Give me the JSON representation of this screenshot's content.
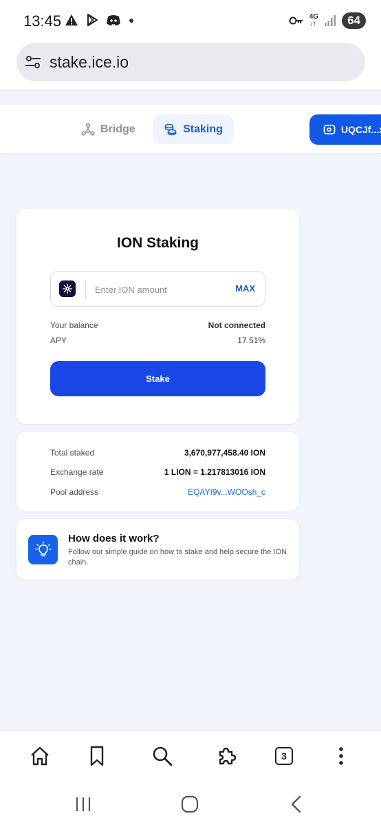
{
  "status_bar": {
    "time": "13:45",
    "network": "4G",
    "battery": "64",
    "icons": [
      "warning-icon",
      "play-store-icon",
      "discord-icon",
      "dot-icon",
      "key-icon",
      "signal-icon"
    ]
  },
  "browser": {
    "url": "stake.ice.io"
  },
  "header": {
    "tab_bridge": "Bridge",
    "tab_staking": "Staking",
    "wallet_label": "UQCJf...x"
  },
  "stake_card": {
    "title": "ION Staking",
    "amount_placeholder": "Enter ION amount",
    "max_label": "MAX",
    "balance_label": "Your balance",
    "balance_value": "Not connected",
    "apy_label": "APY",
    "apy_value": "17.51%",
    "stake_button": "Stake"
  },
  "stats": {
    "total_staked_label": "Total staked",
    "total_staked_value": "3,670,977,458.40 ION",
    "exchange_rate_label": "Exchange rate",
    "exchange_rate_value": "1 LION = 1.217813016 ION",
    "pool_address_label": "Pool address",
    "pool_address_value": "EQAYI9v...WOOsh_c"
  },
  "how_it_works": {
    "title": "How does it work?",
    "description": "Follow our simple guide on how to stake and help secure the ION chain."
  },
  "bottom_nav": {
    "tab_count": "3"
  },
  "colors": {
    "primary_blue": "#1847e6",
    "link_blue": "#1a5fd8",
    "page_bg": "#f1f4fb"
  }
}
